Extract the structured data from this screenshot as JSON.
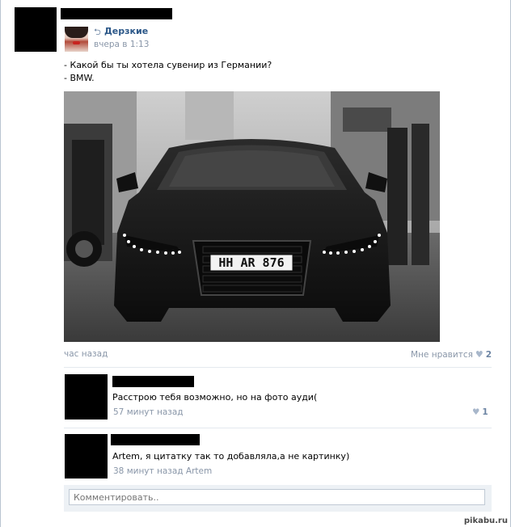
{
  "post": {
    "group_name": "Дерзкие",
    "date": "вчера в 1:13",
    "text_lines": [
      "- Какой бы ты хотела сувенир из Германии?",
      "- BMW."
    ],
    "photo": {
      "plate": "HH AR 876"
    },
    "time_ago": "час назад",
    "like_label": "Мне нравится",
    "like_count": "2"
  },
  "comments": [
    {
      "text": "Расстрою тебя возможно, но на фото ауди(",
      "time": "57 минут назад",
      "like_count": "1"
    },
    {
      "text": "Artem, я цитатку так то добавляла,а не картинку)",
      "time": "38 минут назад",
      "reply_to": "Artem"
    }
  ],
  "comment_box": {
    "placeholder": "Комментировать.."
  },
  "watermark": "pikabu.ru",
  "icons": {
    "repost": "repost-icon",
    "like": "heart-icon"
  },
  "colors": {
    "link": "#2b5788",
    "meta": "#8996a8",
    "like_count": "#6c84a3"
  }
}
